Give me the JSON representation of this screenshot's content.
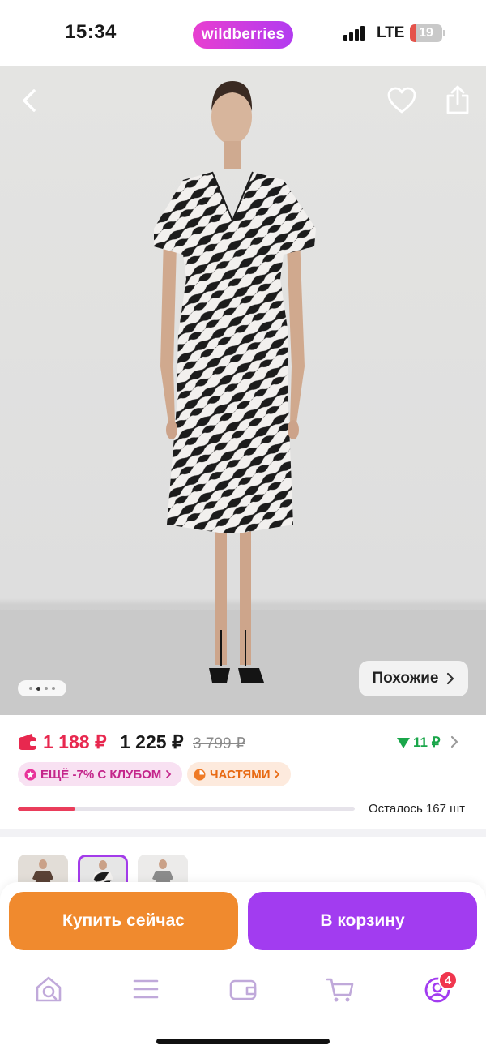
{
  "status_bar": {
    "time": "15:34",
    "brand": "wildberries",
    "network": "LTE",
    "battery": "19",
    "battery_level": 0.19
  },
  "photo": {
    "similar_label": "Похожие",
    "dots_total": 4,
    "dots_active": 2,
    "icons": [
      "back-arrow-icon",
      "heart-icon",
      "share-icon"
    ]
  },
  "price": {
    "wallet_price": "1 188 ₽",
    "price": "1 225 ₽",
    "old_price": "3 799 ₽",
    "drop": "11 ₽"
  },
  "chips": {
    "club": "ЕЩЁ -7% С КЛУБОМ",
    "parts": "ЧАСТЯМИ"
  },
  "stock": {
    "text": "Осталось 167 шт",
    "level": 0.17
  },
  "actions": {
    "buy_now": "Купить сейчас",
    "add_to_cart": "В корзину"
  },
  "nav": {
    "items": [
      "home-icon",
      "catalog-icon",
      "wallet-icon",
      "cart-icon",
      "profile-icon"
    ],
    "profile_badge": "4"
  },
  "colors": {
    "brand_gradient_start": "#e83fd0",
    "brand_gradient_end": "#b23bf0",
    "buy_now": "#f08a2e",
    "add_to_cart": "#a23cf0",
    "wallet_price": "#e8284f",
    "price_drop": "#1aa64a"
  }
}
